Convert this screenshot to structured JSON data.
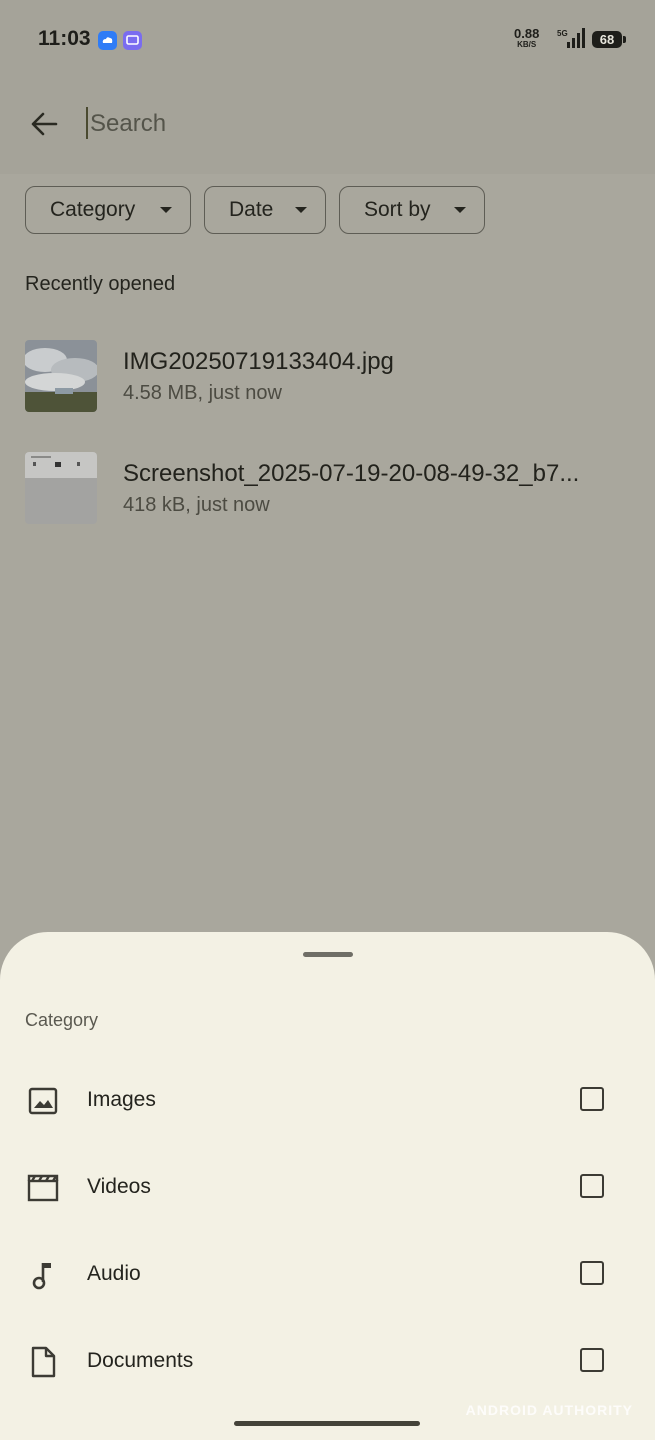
{
  "status_bar": {
    "time": "11:03",
    "network_speed": "0.88",
    "network_unit": "KB/S",
    "network_type": "5G",
    "battery": "68",
    "notif_icon_1_color": "#2f7cf6",
    "notif_icon_2_color": "#7a6cf0"
  },
  "search": {
    "placeholder": "Search",
    "value": ""
  },
  "filters": [
    {
      "label": "Category"
    },
    {
      "label": "Date"
    },
    {
      "label": "Sort by"
    }
  ],
  "recent": {
    "title": "Recently opened",
    "files": [
      {
        "name": "IMG20250719133404.jpg",
        "meta": "4.58 MB, just now"
      },
      {
        "name": "Screenshot_2025-07-19-20-08-49-32_b7...",
        "meta": "418 kB, just now"
      }
    ]
  },
  "sheet": {
    "title": "Category",
    "options": [
      {
        "label": "Images",
        "icon": "image-icon",
        "checked": false
      },
      {
        "label": "Videos",
        "icon": "movie-icon",
        "checked": false
      },
      {
        "label": "Audio",
        "icon": "music-note-icon",
        "checked": false
      },
      {
        "label": "Documents",
        "icon": "document-icon",
        "checked": false
      }
    ]
  },
  "watermark": "ANDROID AUTHORITY"
}
